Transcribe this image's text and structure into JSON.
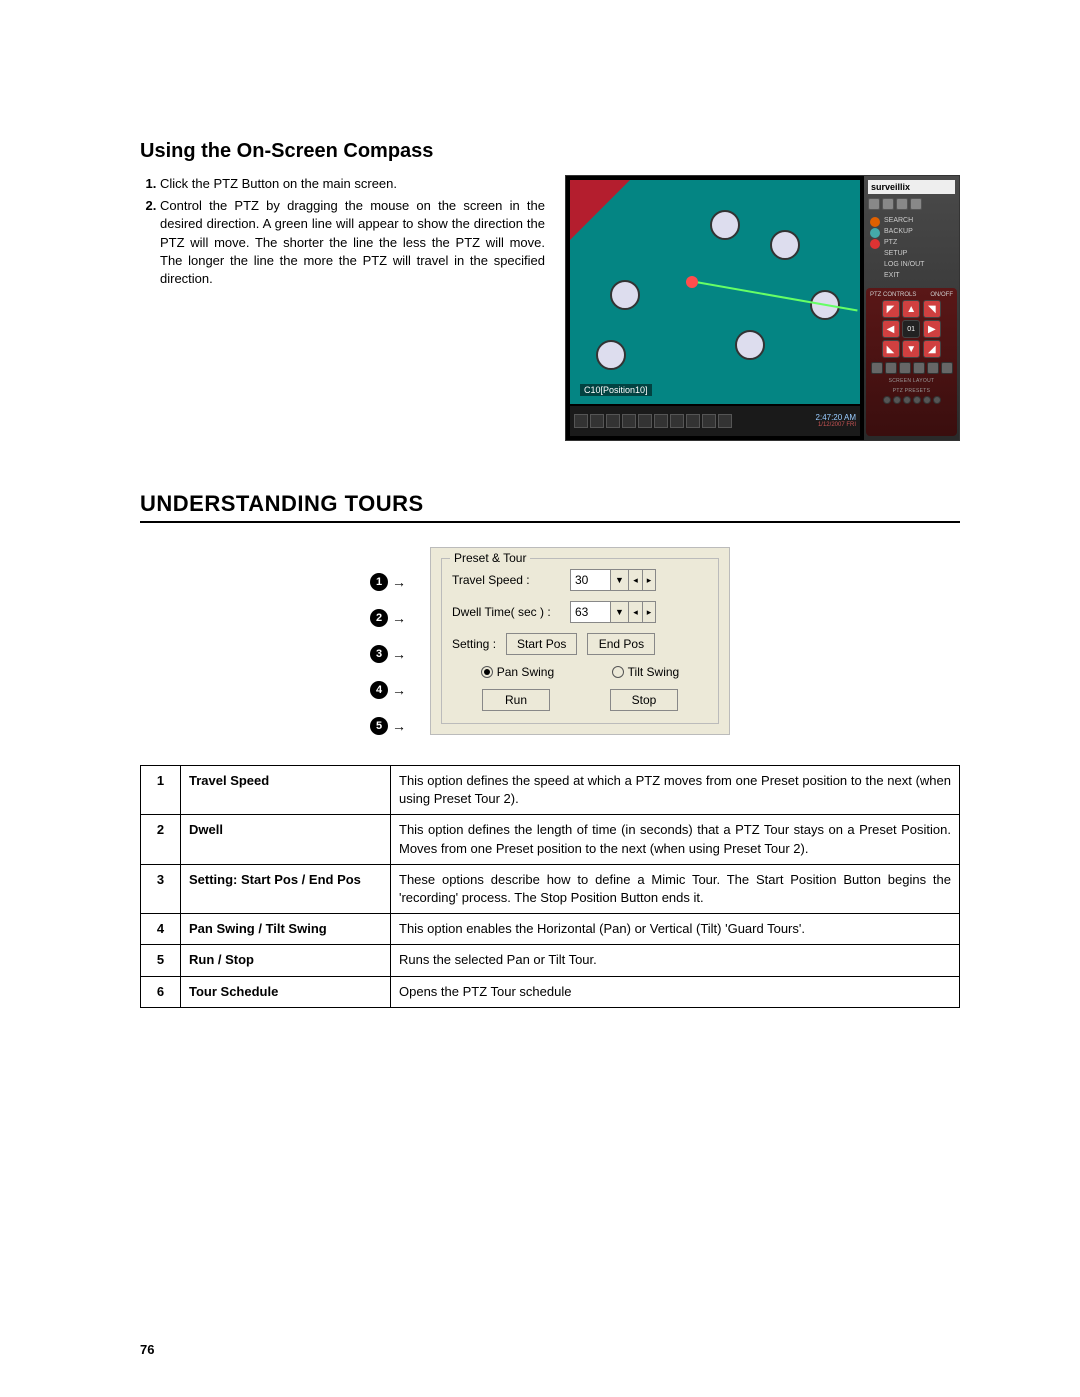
{
  "section1": {
    "heading": "Using the On-Screen Compass",
    "steps": [
      "Click the PTZ Button on the main screen.",
      "Control the PTZ by dragging the mouse on the screen in the desired direction. A green line will appear to show the direction the PTZ will move.  The shorter the line the less the PTZ will move.  The longer the line the more the PTZ will travel in the specified direction."
    ]
  },
  "screenshot": {
    "brand": "surveillix",
    "camera_label": "C10[Position10]",
    "time": "2:47:20 AM",
    "time_sub": "1/12/2007 FRI",
    "side_links": [
      {
        "label": "SEARCH",
        "color": "#e06000"
      },
      {
        "label": "BACKUP",
        "color": "#4aa"
      },
      {
        "label": "PTZ",
        "color": "#d33"
      },
      {
        "label": "SETUP",
        "color": ""
      },
      {
        "label": "LOG IN/OUT",
        "color": ""
      },
      {
        "label": "EXIT",
        "color": ""
      }
    ],
    "ptz_header_left": "PTZ CONTROLS",
    "ptz_header_right": "ON/OFF",
    "ptz_center": "01",
    "ptz_footer1": "SCREEN LAYOUT",
    "ptz_footer2": "PTZ PRESETS"
  },
  "section2": {
    "heading": "UNDERSTANDING TOURS"
  },
  "dialog": {
    "legend": "Preset & Tour",
    "travel_label": "Travel Speed   :",
    "travel_value": "30",
    "dwell_label": "Dwell Time( sec )   :",
    "dwell_value": "63",
    "setting_label": "Setting   :",
    "start_btn": "Start Pos",
    "end_btn": "End Pos",
    "pan_label": "Pan Swing",
    "tilt_label": "Tilt Swing",
    "run_btn": "Run",
    "stop_btn": "Stop"
  },
  "callouts": [
    "1",
    "2",
    "3",
    "4",
    "5"
  ],
  "table": [
    {
      "n": "1",
      "name": "Travel Speed",
      "desc": "This option defines the speed at which a PTZ moves from one Preset position to the next (when using Preset Tour 2)."
    },
    {
      "n": "2",
      "name": "Dwell",
      "desc": "This option defines the length of time (in seconds) that a PTZ Tour stays on a Preset Position.  Moves from one Preset position to the next (when using Preset Tour 2)."
    },
    {
      "n": "3",
      "name": "Setting:  Start Pos / End Pos",
      "desc": "These options describe how to define a Mimic Tour. The Start Position Button begins the 'recording' process. The Stop Position Button ends it."
    },
    {
      "n": "4",
      "name": "Pan Swing / Tilt Swing",
      "desc": "This option enables the Horizontal (Pan) or Vertical (Tilt) 'Guard Tours'."
    },
    {
      "n": "5",
      "name": "Run / Stop",
      "desc": "Runs the selected Pan or Tilt Tour."
    },
    {
      "n": "6",
      "name": "Tour Schedule",
      "desc": "Opens the PTZ Tour schedule"
    }
  ],
  "page_number": "76"
}
